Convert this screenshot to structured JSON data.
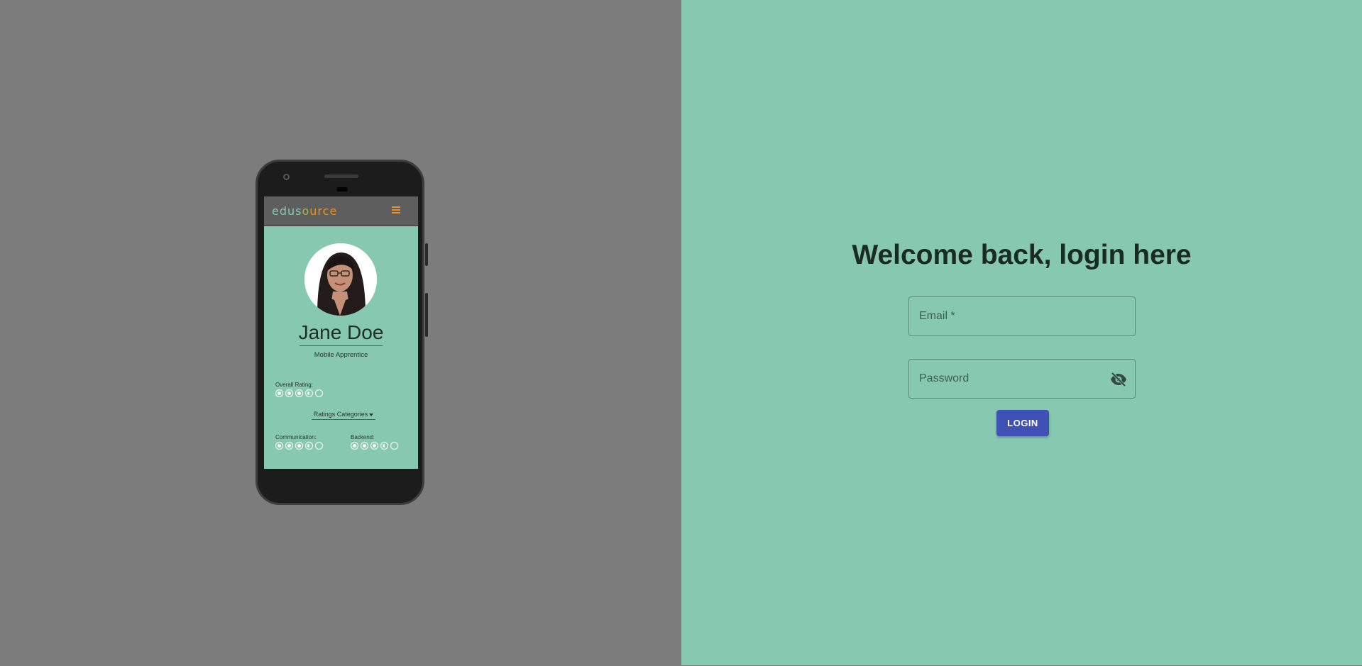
{
  "phone": {
    "app_logo": {
      "edu": "edu",
      "s": "s",
      "o": "o",
      "urce": "urce"
    },
    "profile": {
      "name": "Jane Doe",
      "role": "Mobile Apprentice",
      "overall_label": "Overall Rating:",
      "overall_rating": 3.5,
      "dropdown_label": "Ratings Categories",
      "categories": [
        {
          "label": "Communication:",
          "rating": 3.5
        },
        {
          "label": "Backend:",
          "rating": 3.5
        }
      ]
    }
  },
  "login": {
    "title": "Welcome back, login here",
    "email_placeholder": "Email *",
    "password_placeholder": "Password",
    "button_label": "LOGIN"
  },
  "colors": {
    "left_bg": "#7c7c7c",
    "right_bg": "#86c8b0",
    "button": "#3f51b5",
    "logo_orange": "#e5902b"
  }
}
